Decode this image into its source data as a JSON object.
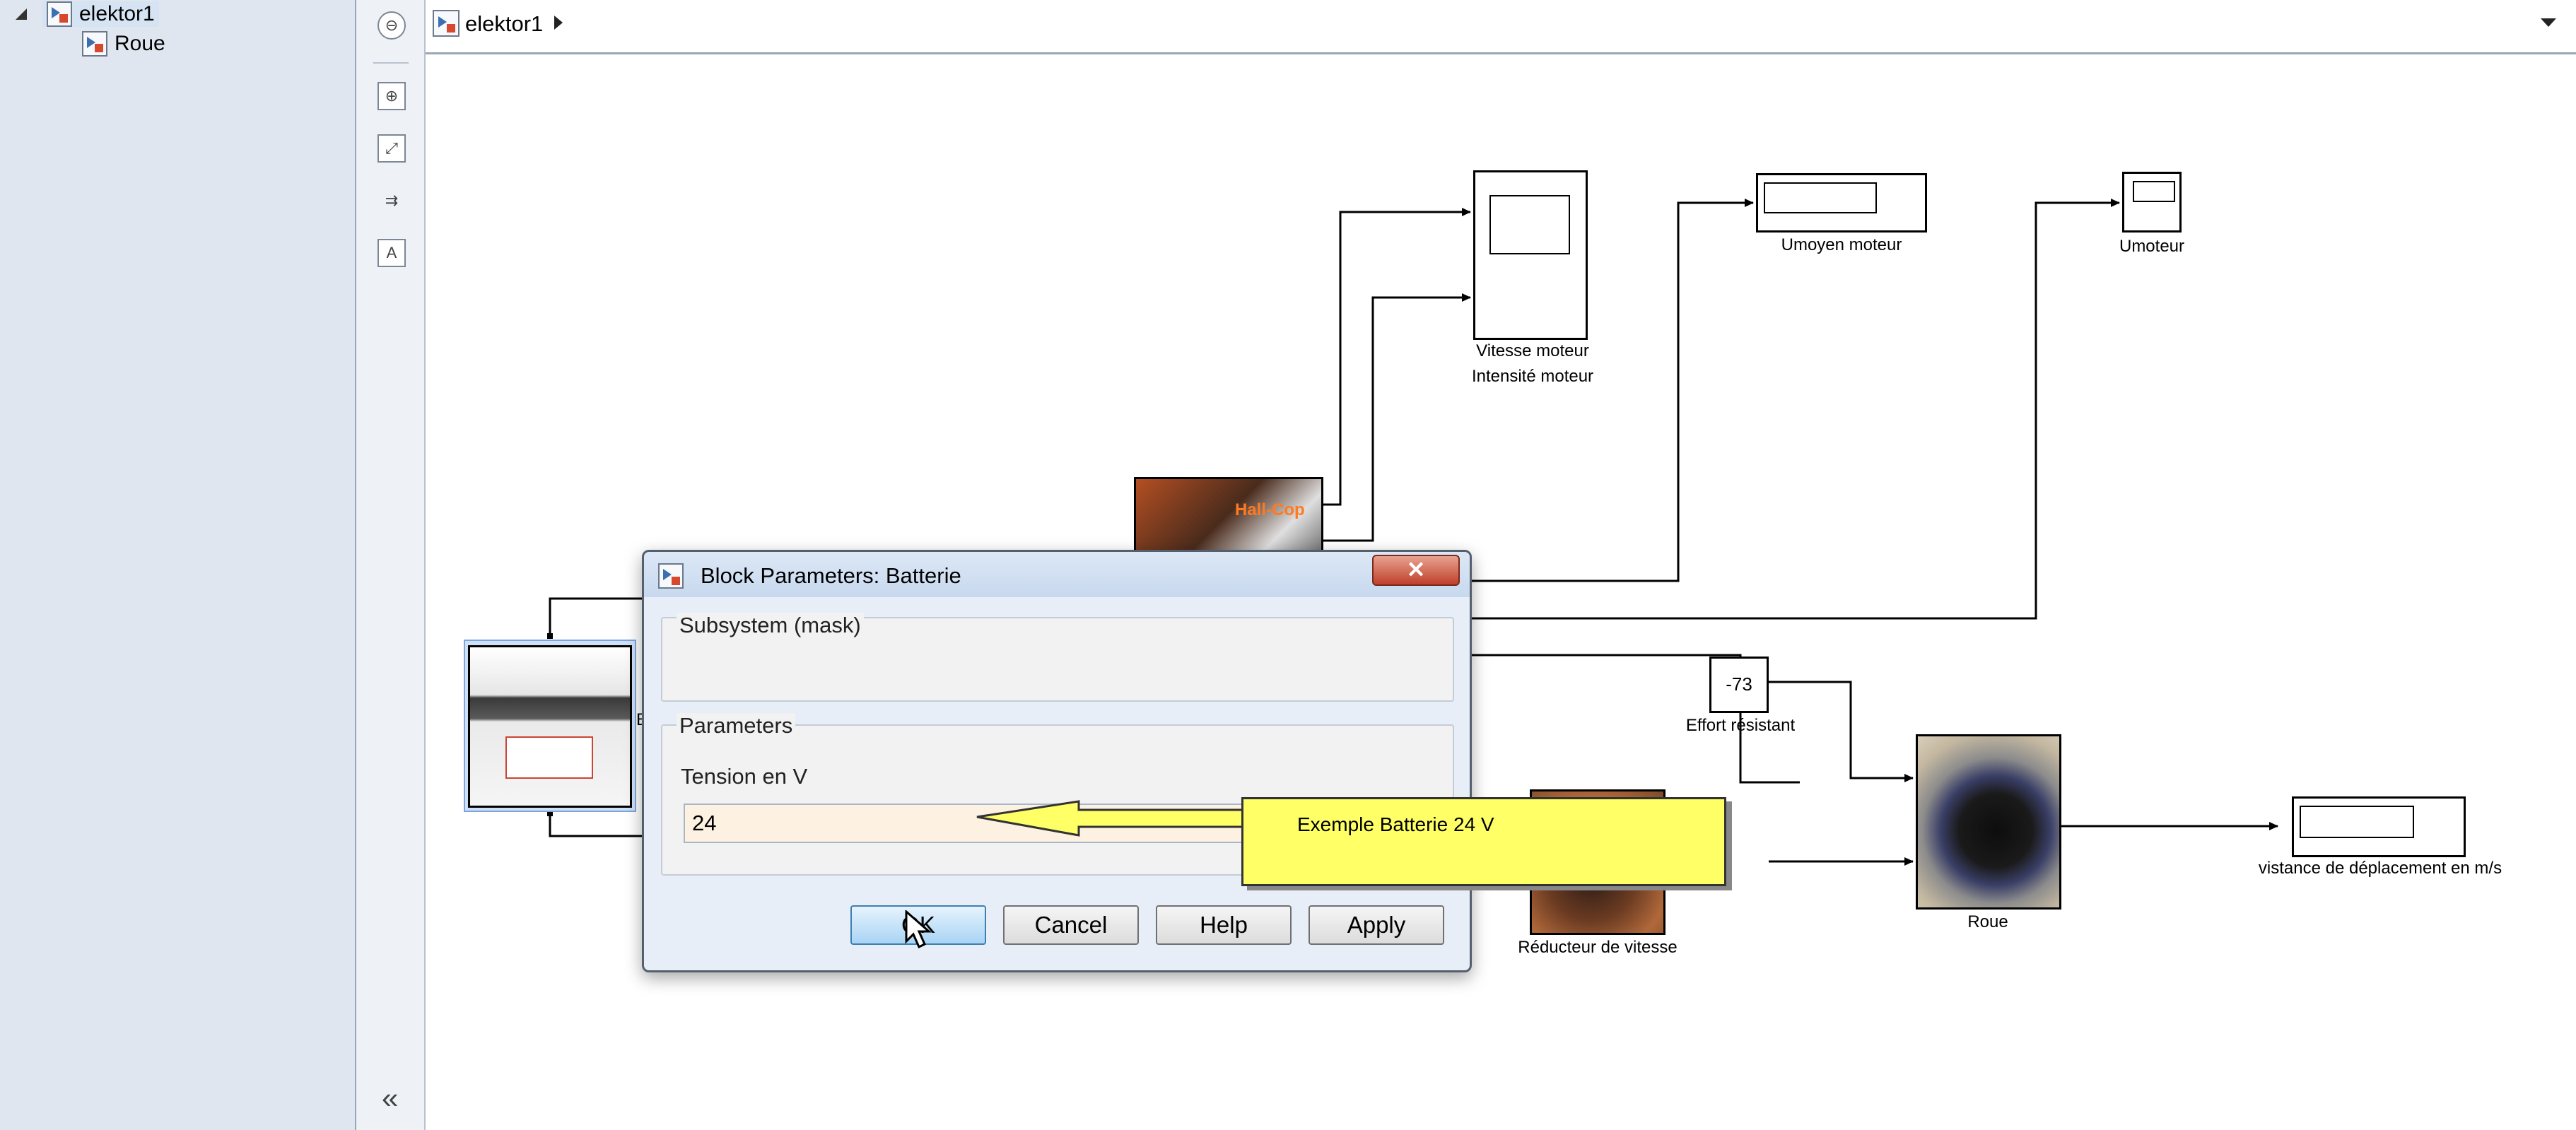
{
  "browser": {
    "items": [
      {
        "label": "elektor1"
      },
      {
        "label": "Roue"
      }
    ]
  },
  "address": {
    "path": "elektor1"
  },
  "palette": {
    "collapse_label": "«"
  },
  "canvas": {
    "blocks": {
      "scope_label_1": "Vitesse moteur",
      "scope_label_2": "Intensité moteur",
      "umoyen": "Umoyen moteur",
      "umoteur": "Umoteur",
      "constant_value": "-73",
      "constant_label": "Effort résistant",
      "roue": "Roue",
      "vitesse_display": "vistance de déplacement en m/s",
      "reducteur": "Réducteur de vitesse",
      "motor_overlay": "Hall-Cop",
      "battery_partial": "B"
    }
  },
  "dialog": {
    "title": "Block Parameters: Batterie",
    "close_label": "✕",
    "group_subsystem": "Subsystem (mask)",
    "group_parameters": "Parameters",
    "tension_label": "Tension en V",
    "tension_value": "24",
    "buttons": {
      "ok": "OK",
      "cancel": "Cancel",
      "help": "Help",
      "apply": "Apply"
    }
  },
  "callout": {
    "text": "Exemple Batterie 24 V"
  },
  "colors": {
    "callout_fill": "#ffff66",
    "title_bar": "#c7d8ee",
    "close_red": "#c0402a"
  }
}
